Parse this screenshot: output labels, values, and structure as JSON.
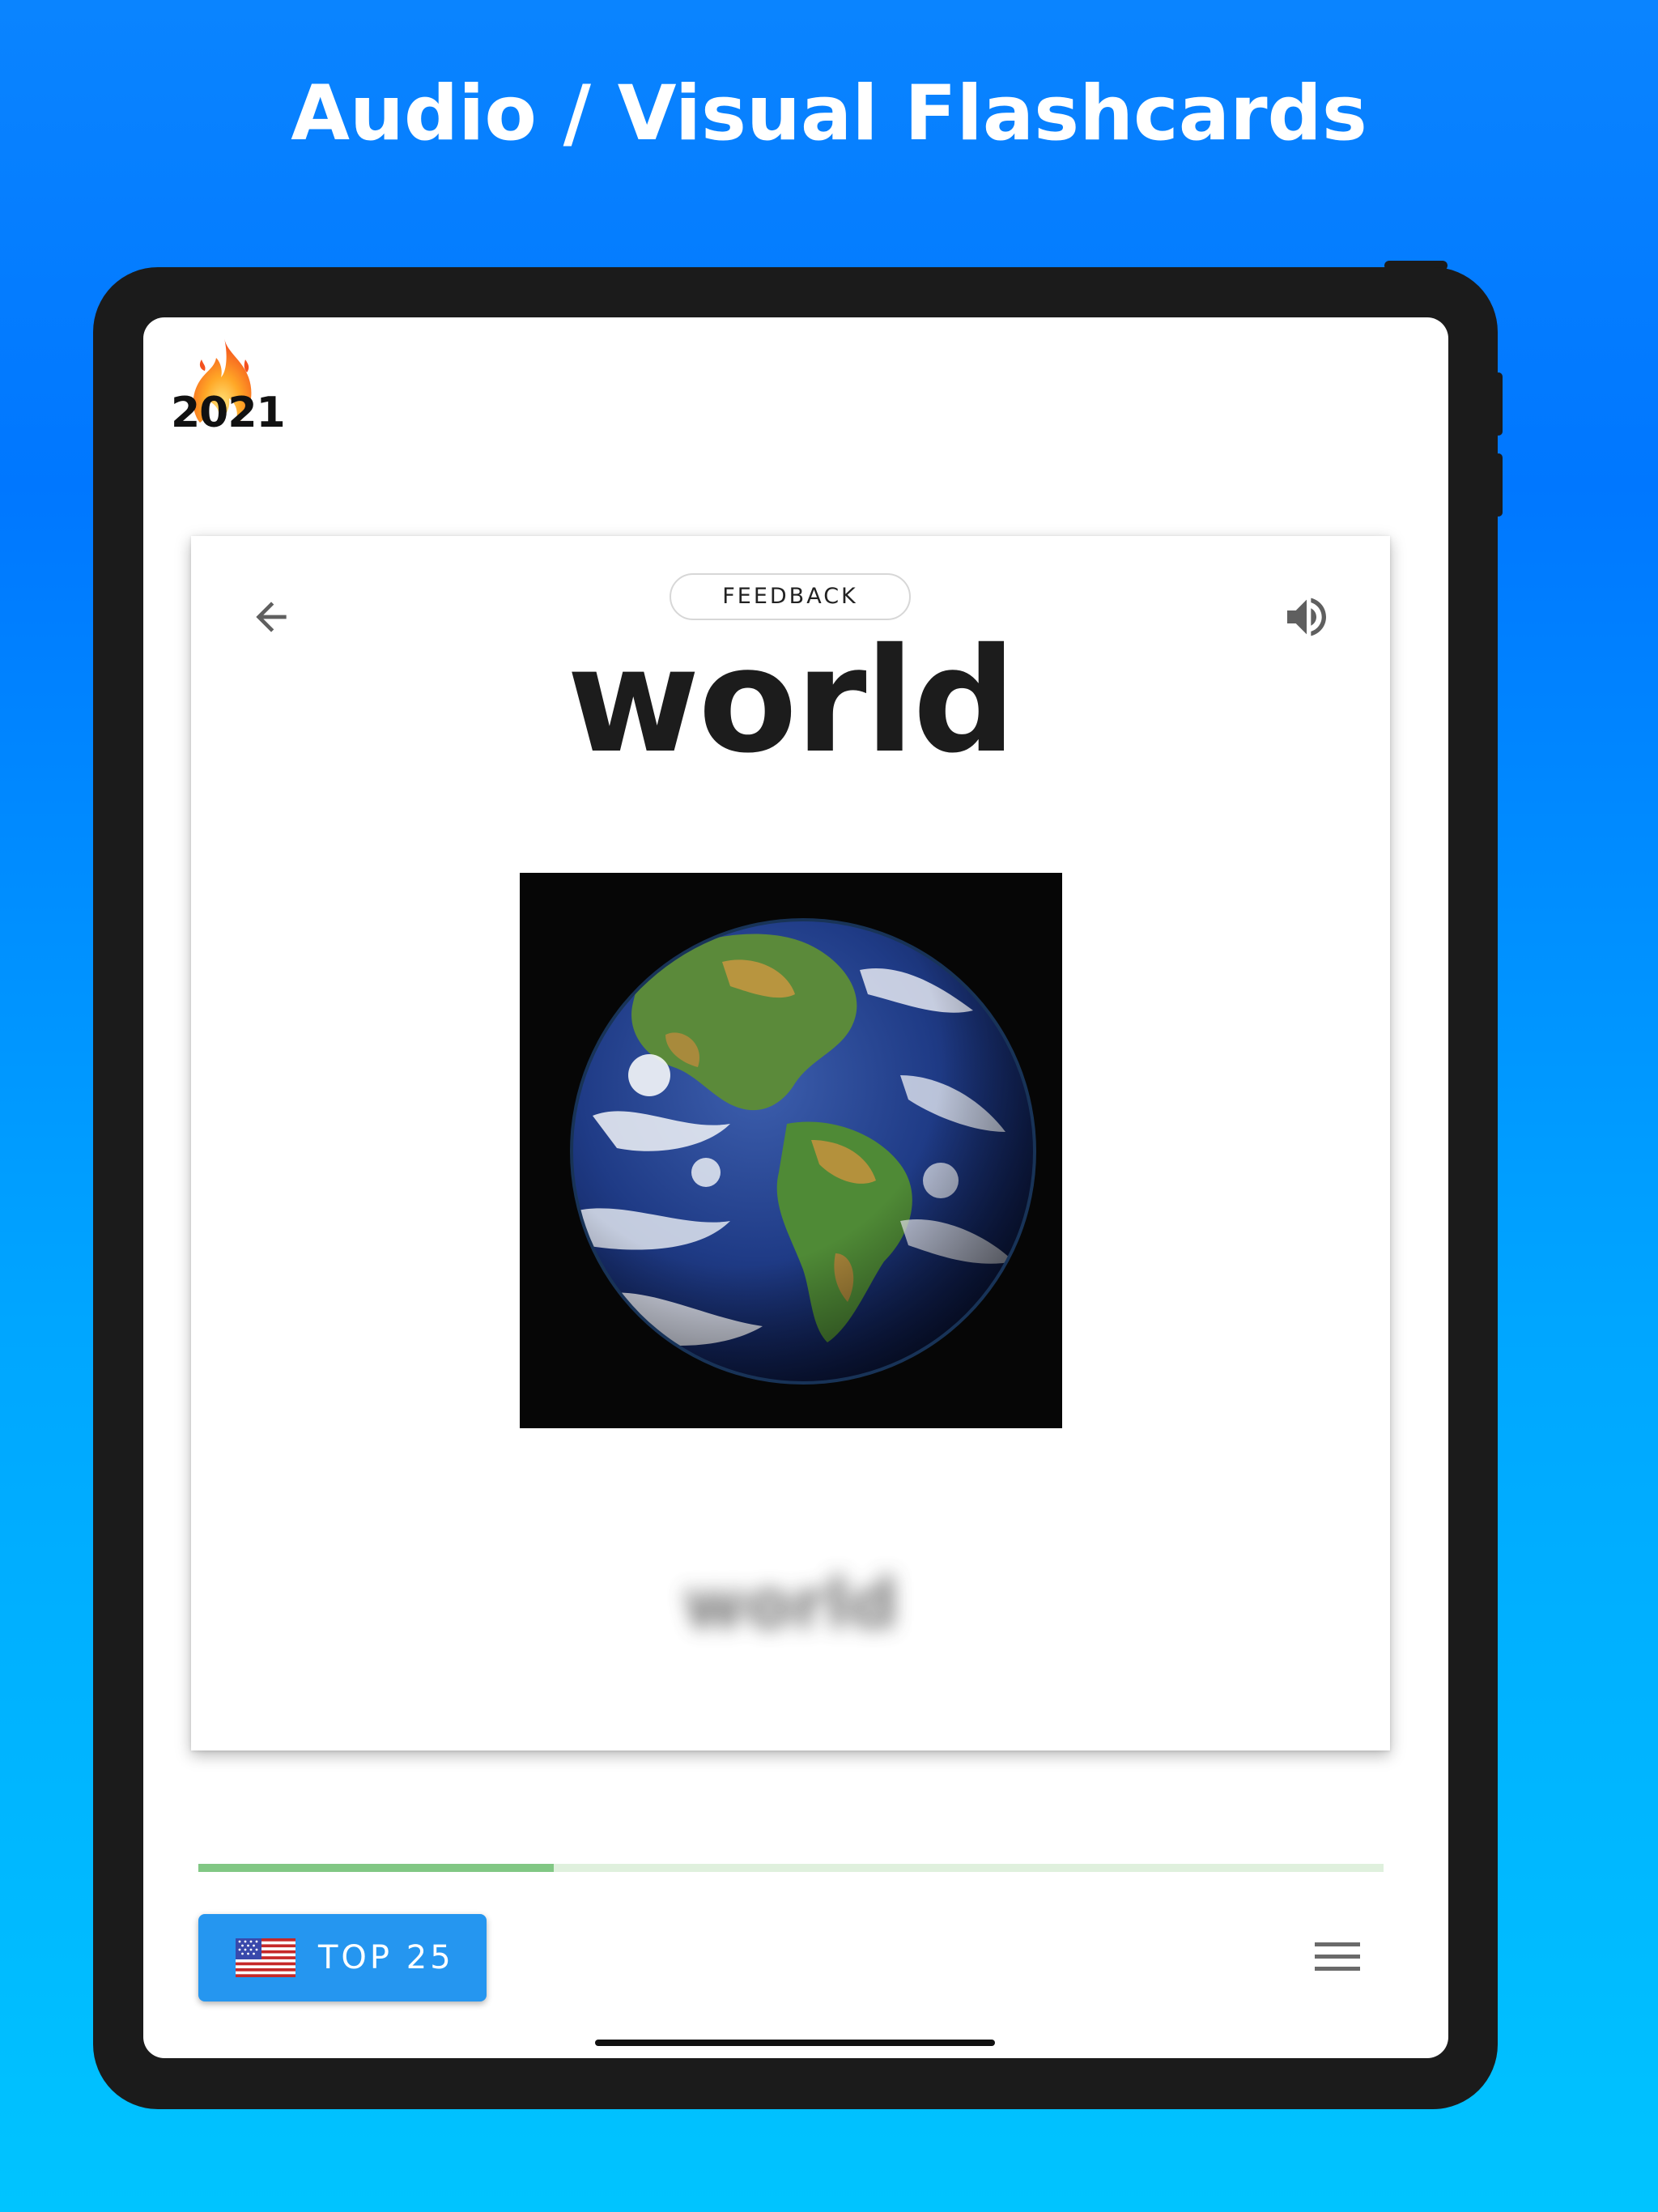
{
  "marketing": {
    "headline": "Audio / Visual Flashcards"
  },
  "app": {
    "badge": {
      "year": "2021",
      "icon": "fire-icon"
    },
    "card": {
      "feedback_label": "FEEDBACK",
      "word": "world",
      "blurred_answer": "world",
      "image_subject": "earth-globe",
      "back_icon": "arrow-left-icon",
      "sound_icon": "speaker-icon"
    },
    "progress": {
      "fraction": 0.3,
      "fill_color": "#81c784",
      "track_color": "#dff0dd"
    },
    "footer": {
      "deck_label": "TOP 25",
      "deck_flag": "us-flag-icon",
      "deck_button_color": "#2596f0",
      "menu_icon": "hamburger-menu-icon"
    }
  }
}
